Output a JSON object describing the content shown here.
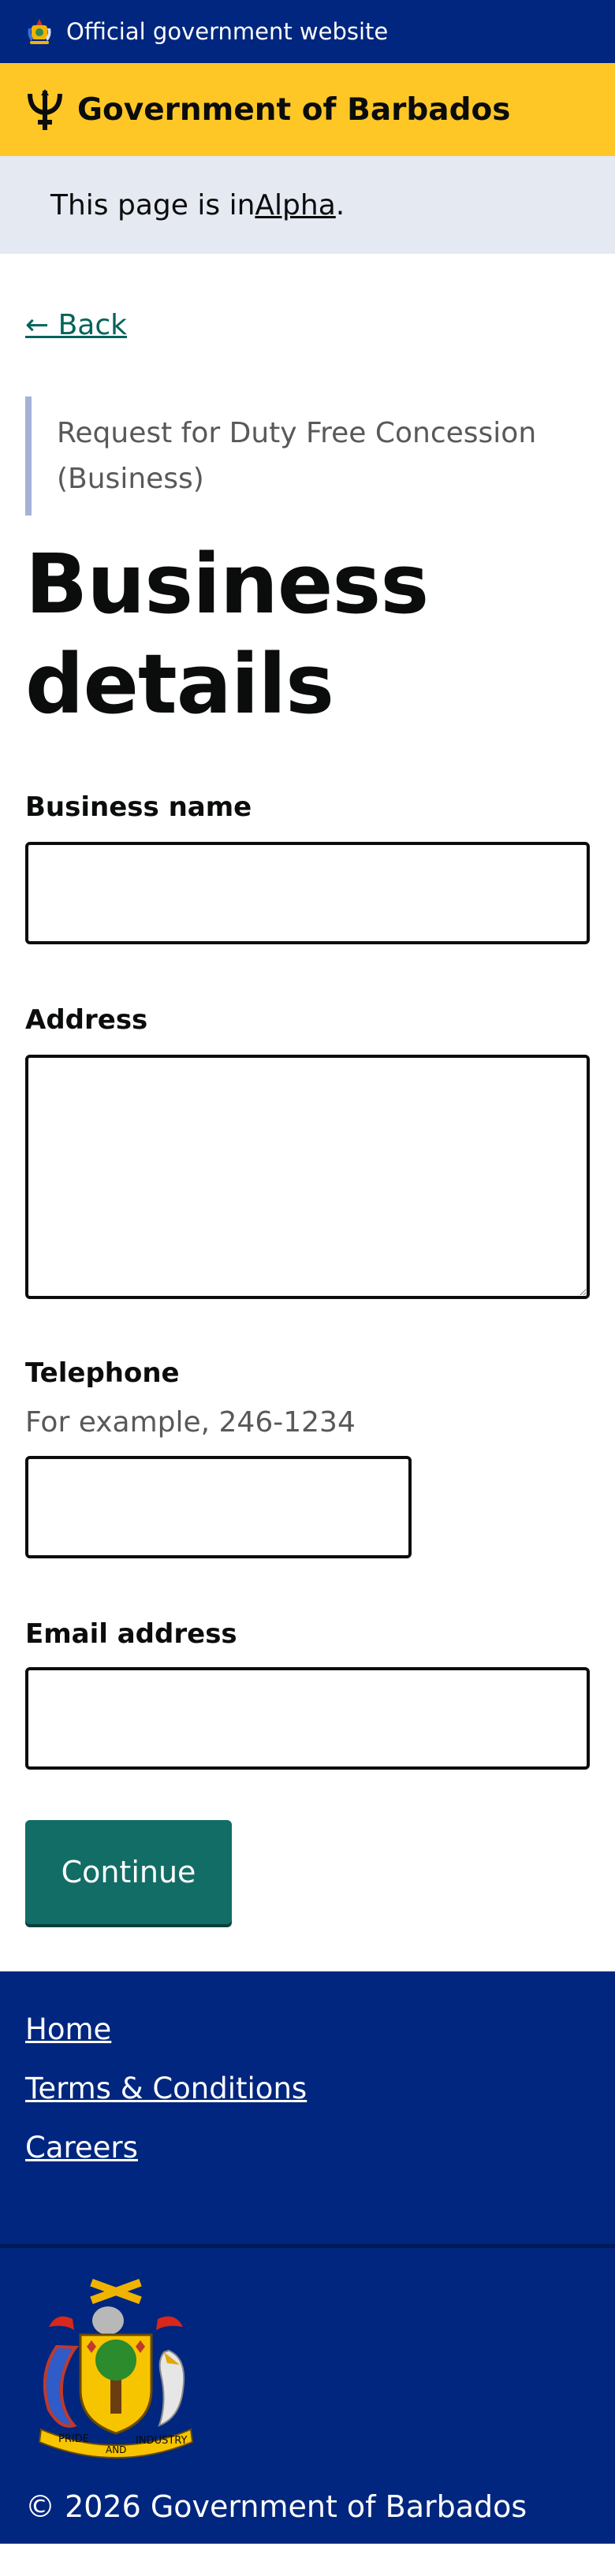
{
  "official_banner": {
    "text": "Official government website"
  },
  "brand": {
    "title": "Government of Barbados"
  },
  "phase_banner": {
    "prefix": "This page is in ",
    "link": "Alpha",
    "suffix": "."
  },
  "back_link": "← Back",
  "caption": "Request for Duty Free Concession (Business)",
  "heading": "Business details",
  "form": {
    "business_name": {
      "label": "Business name",
      "value": "",
      "placeholder": ""
    },
    "address": {
      "label": "Address",
      "value": ""
    },
    "telephone": {
      "label": "Telephone",
      "hint": "For example, 246-1234",
      "value": ""
    },
    "email": {
      "label": "Email address",
      "value": ""
    },
    "continue_label": "Continue"
  },
  "footer": {
    "links": [
      "Home",
      "Terms & Conditions",
      "Careers"
    ],
    "crest_motto": [
      "PRIDE",
      "AND",
      "INDUSTRY"
    ],
    "copyright": "© 2026 Government of Barbados"
  },
  "colors": {
    "navy": "#00267f",
    "yellow": "#ffc726",
    "phase_bg": "#e5e9f2",
    "button": "#126d66",
    "link": "#00645a"
  }
}
